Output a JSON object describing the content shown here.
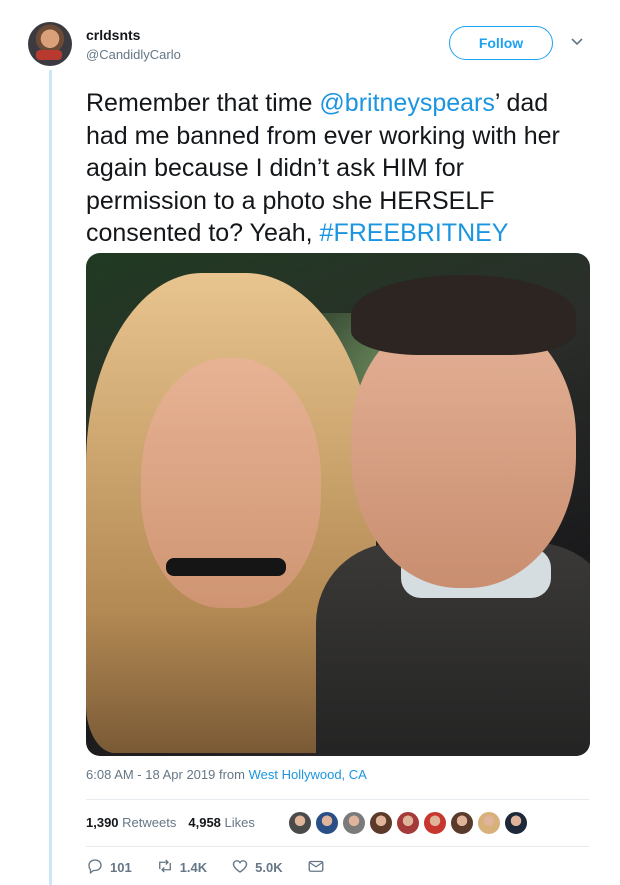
{
  "tweet": {
    "display_name": "crldsnts",
    "handle": "@CandidlyCarlo",
    "follow_label": "Follow",
    "text_parts": [
      "Remember that time ",
      "@britneyspears",
      "’ dad had me banned from ever working with her again because I didn’t ask HIM for permission to a photo she HERSELF consented to? Yeah, ",
      "#FREEBRITNEY"
    ],
    "timestamp": "6:08 AM - 18 Apr 2019 from ",
    "location": "West Hollywood, CA",
    "retweets_count": "1,390",
    "retweets_label": "Retweets",
    "likes_count": "4,958",
    "likes_label": "Likes",
    "replies": "101",
    "retweets_short": "1.4K",
    "likes_short": "5.0K"
  },
  "colors": {
    "accent": "#1da1f2",
    "link": "#1b95e0",
    "muted": "#657786",
    "thread_line": "#cde7f6"
  },
  "icons": [
    "chevron-down-icon",
    "reply-icon",
    "retweet-icon",
    "heart-icon",
    "dm-envelope-icon"
  ],
  "liker_avatar_colors": [
    "#4a4a4a",
    "#2a4e86",
    "#7b7b7b",
    "#5b3a29",
    "#a43a3a",
    "#c7372f",
    "#5a3a2a",
    "#d8b07a",
    "#1d2838"
  ]
}
